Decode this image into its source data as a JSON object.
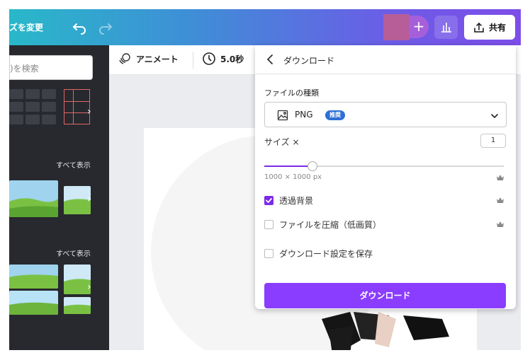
{
  "topbar": {
    "resize_label": "ズを変更",
    "share_label": "共有",
    "avatar_color": "#b75d97",
    "add_symbol": "+"
  },
  "left_panel": {
    "search_placeholder": ")を検索",
    "see_all_1": "すべて表示",
    "see_all_2": "すべて表示",
    "collapse_symbol": "‹"
  },
  "canvas_toolbar": {
    "animate_label": "アニメート",
    "duration_label": "5.0秒"
  },
  "download_panel": {
    "title": "ダウンロード",
    "filetype_label": "ファイルの種類",
    "filetype_value": "PNG",
    "filetype_badge": "推奨",
    "size_label": "サイズ ×",
    "size_value": "1",
    "size_slider_fraction": 0.2,
    "dimensions_label": "1000 × 1000 px",
    "options": [
      {
        "label": "透過背景",
        "checked": true,
        "premium": true
      },
      {
        "label": "ファイルを圧縮（低画質）",
        "checked": false,
        "premium": true
      },
      {
        "label": "ダウンロード設定を保存",
        "checked": false,
        "premium": false
      }
    ],
    "download_button": "ダウンロード"
  },
  "colors": {
    "accent": "#8b3dff",
    "topbar_gradient": [
      "#29b8c9",
      "#7d4de8"
    ],
    "badge_blue": "#2f6fd6",
    "left_panel_bg": "#27292e"
  },
  "icons": [
    "undo-icon",
    "redo-icon",
    "stats-icon",
    "share-icon",
    "animate-icon",
    "clock-icon",
    "back-icon",
    "image-icon",
    "caret-down-icon",
    "crown-icon",
    "check-icon"
  ]
}
